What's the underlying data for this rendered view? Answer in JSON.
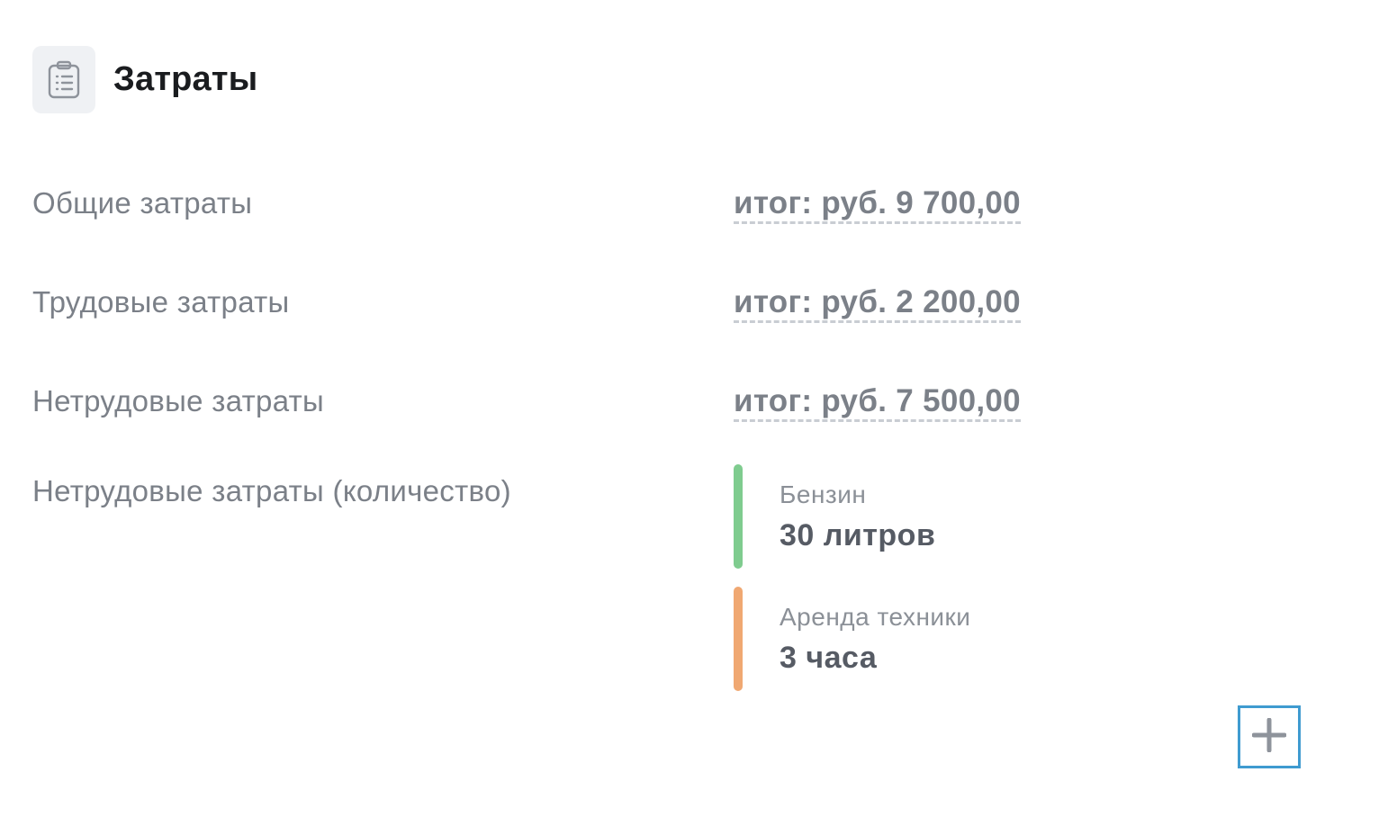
{
  "header": {
    "icon": "clipboard-list-icon",
    "title": "Затраты"
  },
  "rows": [
    {
      "label": "Общие затраты",
      "value": "итог: руб. 9 700,00"
    },
    {
      "label": "Трудовые затраты",
      "value": "итог: руб. 2 200,00"
    },
    {
      "label": "Нетрудовые затраты",
      "value": "итог: руб. 7 500,00"
    }
  ],
  "quantity": {
    "label": "Нетрудовые затраты (количество)",
    "items": [
      {
        "name": "Бензин",
        "amount": "30 литров",
        "color": "#7fcc8f"
      },
      {
        "name": "Аренда техники",
        "amount": "3 часа",
        "color": "#f0a872"
      }
    ]
  },
  "add_button": {
    "icon": "plus-icon"
  }
}
